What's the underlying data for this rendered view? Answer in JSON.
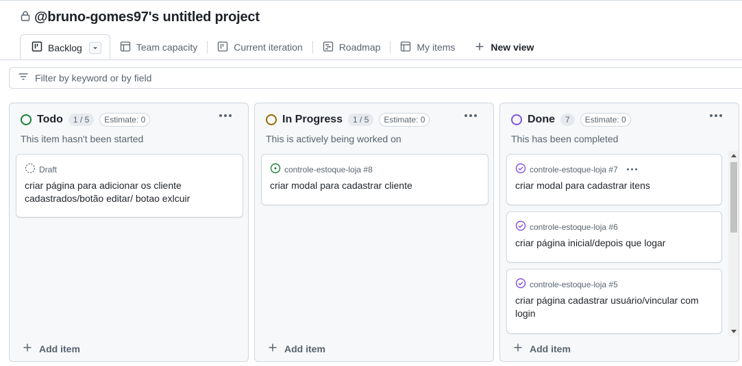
{
  "project": {
    "title": "@bruno-gomes97's untitled project"
  },
  "tabs": [
    {
      "label": "Backlog",
      "icon": "board-icon",
      "active": true
    },
    {
      "label": "Team capacity",
      "icon": "table-icon"
    },
    {
      "label": "Current iteration",
      "icon": "board-icon"
    },
    {
      "label": "Roadmap",
      "icon": "roadmap-icon"
    },
    {
      "label": "My items",
      "icon": "table-icon"
    },
    {
      "label": "New view",
      "icon": "plus-icon"
    }
  ],
  "filter": {
    "placeholder": "Filter by keyword or by field"
  },
  "columns": [
    {
      "name": "Todo",
      "count": "1 / 5",
      "estimate": "Estimate: 0",
      "description": "This item hasn't been started",
      "color": "#1a7f37",
      "cards": [
        {
          "meta": "Draft",
          "title": "criar página para adicionar os cliente cadastrados/botão editar/ botao exlcuir"
        }
      ],
      "add_label": "Add item"
    },
    {
      "name": "In Progress",
      "count": "1 / 5",
      "estimate": "Estimate: 0",
      "description": "This is actively being worked on",
      "color": "#9a6700",
      "cards": [
        {
          "meta": "controle-estoque-loja #8",
          "title": "criar modal para cadastrar cliente"
        }
      ],
      "add_label": "Add item"
    },
    {
      "name": "Done",
      "count": "7",
      "estimate": "Estimate: 0",
      "description": "This has been completed",
      "color": "#8250df",
      "cards": [
        {
          "meta": "controle-estoque-loja #7",
          "title": "criar modal para cadastrar itens"
        },
        {
          "meta": "controle-estoque-loja #6",
          "title": "criar página inicial/depois que logar"
        },
        {
          "meta": "controle-estoque-loja #5",
          "title": "criar página cadastrar usuário/vincular com login"
        }
      ],
      "add_label": "Add item"
    }
  ]
}
